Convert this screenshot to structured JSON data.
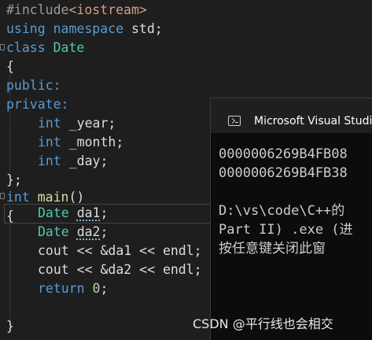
{
  "code": {
    "l1_pre": "#include",
    "l1_inc": "<iostream>",
    "l2_kw1": "using",
    "l2_kw2": "namespace",
    "l2_rest": " std;",
    "l3_kw": "class",
    "l3_name": "Date",
    "l4": "{",
    "l5": "public:",
    "l6": "private:",
    "l7_type": "int",
    "l7_var": " _year;",
    "l8_type": "int",
    "l8_var": " _month;",
    "l9_type": "int",
    "l9_var": " _day;",
    "l10": "};",
    "l11_type": "int",
    "l11_fn": "main",
    "l11_rest": "()",
    "l12": "{",
    "l13_type": "Date",
    "l13_var": "da1",
    "l13_end": ";",
    "l14_type": "Date",
    "l14_var": "da2",
    "l14_end": ";",
    "l15": "cout << &da1 << endl;",
    "l16": "cout << &da2 << endl;",
    "l17_kw": "return",
    "l17_num": "0",
    "l17_end": ";",
    "l18": "}"
  },
  "console": {
    "title": "Microsoft Visual Studi",
    "lines": [
      "0000006269B4FB08",
      "0000006269B4FB38",
      "",
      "D:\\vs\\code\\C++的",
      "Part II) .exe (进",
      "按任意键关闭此窗"
    ]
  },
  "watermark": "CSDN @平行线也会相交"
}
